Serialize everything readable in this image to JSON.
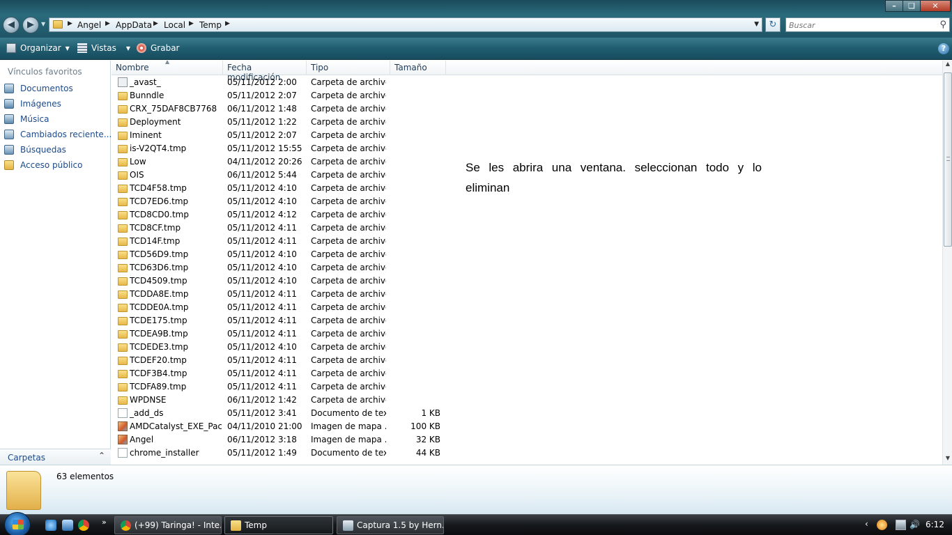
{
  "window": {
    "breadcrumb": [
      "Angel",
      "AppData",
      "Local",
      "Temp"
    ],
    "search_placeholder": "Buscar"
  },
  "toolbar": {
    "organize_label": "Organizar",
    "views_label": "Vistas",
    "burn_label": "Grabar"
  },
  "navpane": {
    "favorites_heading": "Vínculos favoritos",
    "items": [
      "Documentos",
      "Imágenes",
      "Música",
      "Cambiados reciente...",
      "Búsquedas",
      "Acceso público"
    ],
    "folders_label": "Carpetas"
  },
  "list": {
    "columns": [
      "Nombre",
      "Fecha modificación",
      "Tipo",
      "Tamaño"
    ],
    "rows": [
      {
        "icon": "system-file-icon",
        "name": "_avast_",
        "date": "05/11/2012 2:00",
        "type": "Carpeta de archivos",
        "size": ""
      },
      {
        "icon": "folder-icon",
        "name": "Bunndle",
        "date": "05/11/2012 2:07",
        "type": "Carpeta de archivos",
        "size": ""
      },
      {
        "icon": "folder-icon",
        "name": "CRX_75DAF8CB7768",
        "date": "06/11/2012 1:48",
        "type": "Carpeta de archivos",
        "size": ""
      },
      {
        "icon": "folder-icon",
        "name": "Deployment",
        "date": "05/11/2012 1:22",
        "type": "Carpeta de archivos",
        "size": ""
      },
      {
        "icon": "folder-icon",
        "name": "Iminent",
        "date": "05/11/2012 2:07",
        "type": "Carpeta de archivos",
        "size": ""
      },
      {
        "icon": "folder-icon",
        "name": "is-V2QT4.tmp",
        "date": "05/11/2012 15:55",
        "type": "Carpeta de archivos",
        "size": ""
      },
      {
        "icon": "folder-icon",
        "name": "Low",
        "date": "04/11/2012 20:26",
        "type": "Carpeta de archivos",
        "size": ""
      },
      {
        "icon": "folder-icon",
        "name": "OIS",
        "date": "06/11/2012 5:44",
        "type": "Carpeta de archivos",
        "size": ""
      },
      {
        "icon": "folder-icon",
        "name": "TCD4F58.tmp",
        "date": "05/11/2012 4:10",
        "type": "Carpeta de archivos",
        "size": ""
      },
      {
        "icon": "folder-icon",
        "name": "TCD7ED6.tmp",
        "date": "05/11/2012 4:10",
        "type": "Carpeta de archivos",
        "size": ""
      },
      {
        "icon": "folder-icon",
        "name": "TCD8CD0.tmp",
        "date": "05/11/2012 4:12",
        "type": "Carpeta de archivos",
        "size": ""
      },
      {
        "icon": "folder-icon",
        "name": "TCD8CF.tmp",
        "date": "05/11/2012 4:11",
        "type": "Carpeta de archivos",
        "size": ""
      },
      {
        "icon": "folder-icon",
        "name": "TCD14F.tmp",
        "date": "05/11/2012 4:11",
        "type": "Carpeta de archivos",
        "size": ""
      },
      {
        "icon": "folder-icon",
        "name": "TCD56D9.tmp",
        "date": "05/11/2012 4:10",
        "type": "Carpeta de archivos",
        "size": ""
      },
      {
        "icon": "folder-icon",
        "name": "TCD63D6.tmp",
        "date": "05/11/2012 4:10",
        "type": "Carpeta de archivos",
        "size": ""
      },
      {
        "icon": "folder-icon",
        "name": "TCD4509.tmp",
        "date": "05/11/2012 4:10",
        "type": "Carpeta de archivos",
        "size": ""
      },
      {
        "icon": "folder-icon",
        "name": "TCDDA8E.tmp",
        "date": "05/11/2012 4:11",
        "type": "Carpeta de archivos",
        "size": ""
      },
      {
        "icon": "folder-icon",
        "name": "TCDDE0A.tmp",
        "date": "05/11/2012 4:11",
        "type": "Carpeta de archivos",
        "size": ""
      },
      {
        "icon": "folder-icon",
        "name": "TCDE175.tmp",
        "date": "05/11/2012 4:11",
        "type": "Carpeta de archivos",
        "size": ""
      },
      {
        "icon": "folder-icon",
        "name": "TCDEA9B.tmp",
        "date": "05/11/2012 4:11",
        "type": "Carpeta de archivos",
        "size": ""
      },
      {
        "icon": "folder-icon",
        "name": "TCDEDE3.tmp",
        "date": "05/11/2012 4:10",
        "type": "Carpeta de archivos",
        "size": ""
      },
      {
        "icon": "folder-icon",
        "name": "TCDEF20.tmp",
        "date": "05/11/2012 4:11",
        "type": "Carpeta de archivos",
        "size": ""
      },
      {
        "icon": "folder-icon",
        "name": "TCDF3B4.tmp",
        "date": "05/11/2012 4:11",
        "type": "Carpeta de archivos",
        "size": ""
      },
      {
        "icon": "folder-icon",
        "name": "TCDFA89.tmp",
        "date": "05/11/2012 4:11",
        "type": "Carpeta de archivos",
        "size": ""
      },
      {
        "icon": "folder-icon",
        "name": "WPDNSE",
        "date": "06/11/2012 1:42",
        "type": "Carpeta de archivos",
        "size": ""
      },
      {
        "icon": "document-icon",
        "name": "_add_ds",
        "date": "05/11/2012 3:41",
        "type": "Documento de tex...",
        "size": "1 KB"
      },
      {
        "icon": "bitmap-image-icon",
        "name": "AMDCatalyst_EXE_Pac...",
        "date": "04/11/2010 21:00",
        "type": "Imagen de mapa ...",
        "size": "100 KB"
      },
      {
        "icon": "bitmap-image-icon",
        "name": "Angel",
        "date": "06/11/2012 3:18",
        "type": "Imagen de mapa ...",
        "size": "32 KB"
      },
      {
        "icon": "document-icon",
        "name": "chrome_installer",
        "date": "05/11/2012 1:49",
        "type": "Documento de tex...",
        "size": "44 KB"
      }
    ]
  },
  "note": "Se les abrira una ventana. seleccionan todo y lo eliminan",
  "details": {
    "count": "63 elementos"
  },
  "taskbar": {
    "tasks": [
      "(+99) Taringa! - Inte...",
      "Temp",
      "Captura 1.5 by Hern..."
    ],
    "clock": "6:12"
  }
}
